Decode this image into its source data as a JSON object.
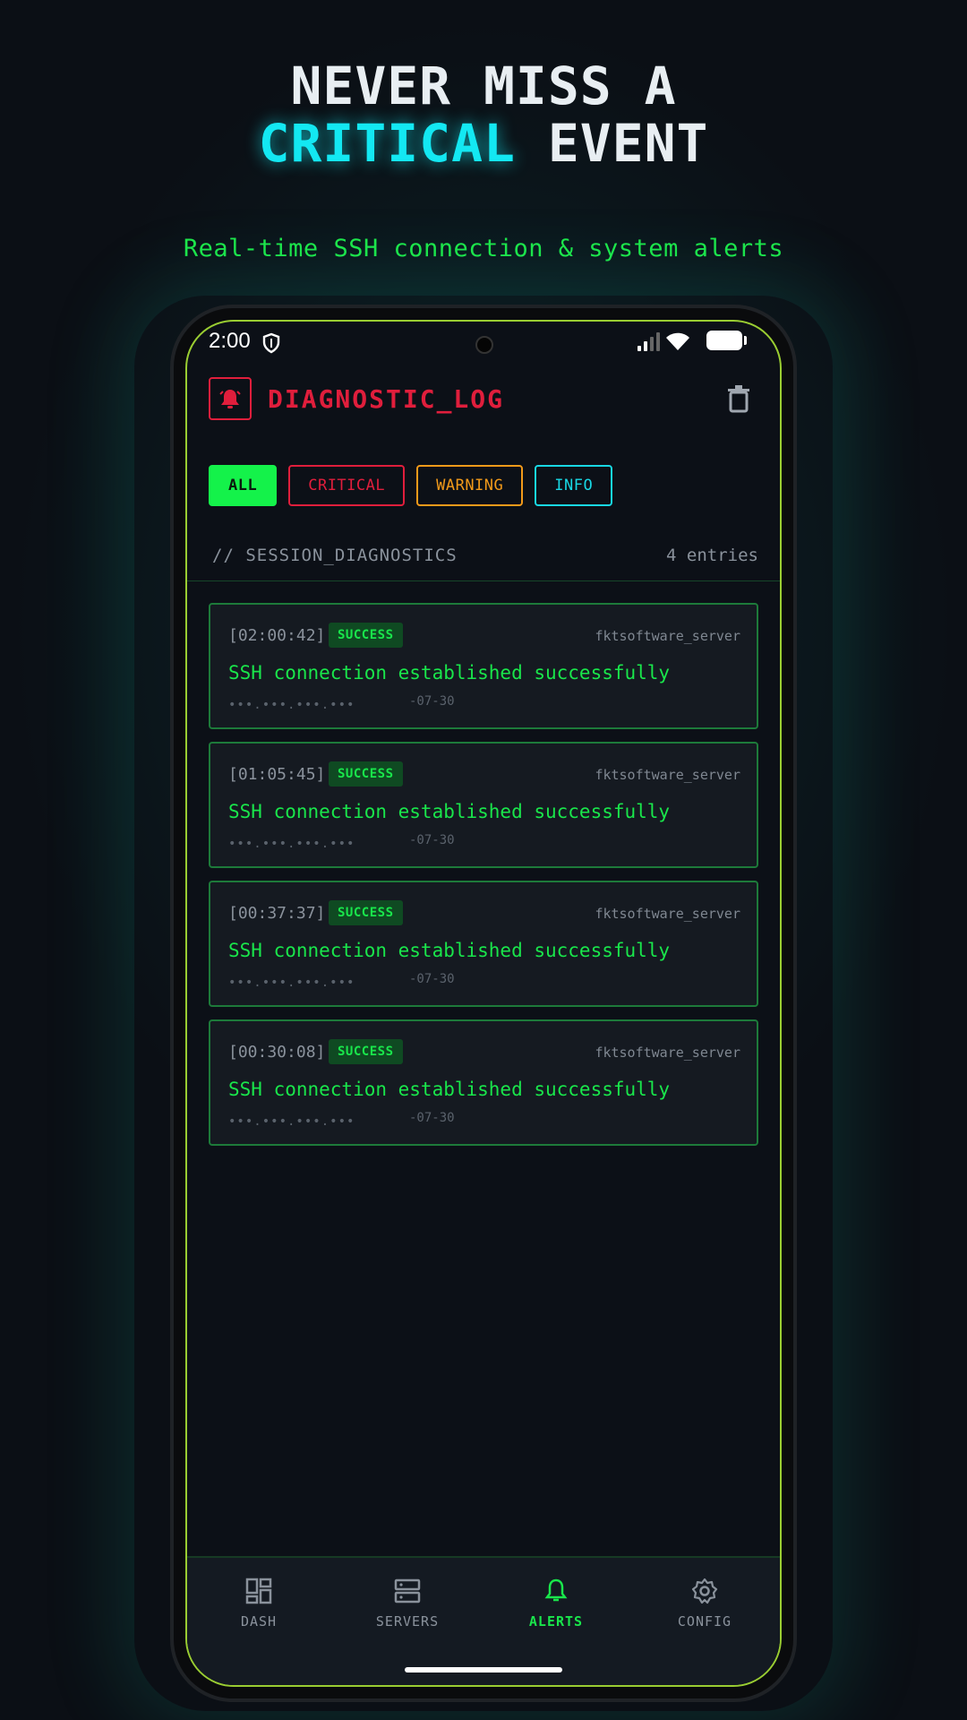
{
  "promo": {
    "line1": "NEVER MISS A",
    "line2_accent": "CRITICAL",
    "line2_rest": " EVENT",
    "subtitle": "Real-time SSH connection & system alerts"
  },
  "status_bar": {
    "time": "2:00"
  },
  "app": {
    "title": "DIAGNOSTIC_LOG",
    "icons": {
      "header": "alarm-bell-icon",
      "action": "trash-icon"
    }
  },
  "filters": [
    {
      "label": "ALL",
      "active": true
    },
    {
      "label": "CRITICAL"
    },
    {
      "label": "WARNING"
    },
    {
      "label": "INFO"
    }
  ],
  "section": {
    "title": "// SESSION_DIAGNOSTICS",
    "count": "4 entries"
  },
  "entries": [
    {
      "time": "[02:00:42]",
      "badge": "SUCCESS",
      "server": "fktsoftware_server",
      "message": "SSH connection established successfully",
      "ip": "•••.•••.•••.•••",
      "date": "-07-30"
    },
    {
      "time": "[01:05:45]",
      "badge": "SUCCESS",
      "server": "fktsoftware_server",
      "message": "SSH connection established successfully",
      "ip": "•••.•••.•••.•••",
      "date": "-07-30"
    },
    {
      "time": "[00:37:37]",
      "badge": "SUCCESS",
      "server": "fktsoftware_server",
      "message": "SSH connection established successfully",
      "ip": "•••.•••.•••.•••",
      "date": "-07-30"
    },
    {
      "time": "[00:30:08]",
      "badge": "SUCCESS",
      "server": "fktsoftware_server",
      "message": "SSH connection established successfully",
      "ip": "•••.•••.•••.•••",
      "date": "-07-30"
    }
  ],
  "nav": [
    {
      "label": "DASH",
      "icon": "dashboard-icon"
    },
    {
      "label": "SERVERS",
      "icon": "servers-icon"
    },
    {
      "label": "ALERTS",
      "icon": "bell-icon",
      "active": true
    },
    {
      "label": "CONFIG",
      "icon": "gear-icon"
    }
  ],
  "colors": {
    "critical": "#e01e3c",
    "success": "#19e64b",
    "warning": "#f29a1a",
    "info": "#18d8e4",
    "accent_cyan": "#13e8f2"
  }
}
